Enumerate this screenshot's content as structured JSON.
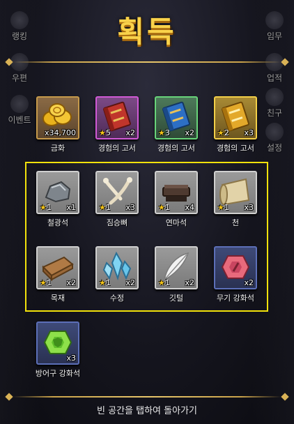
{
  "title": "획득",
  "side_menu": {
    "left": [
      "랭킹",
      "우편",
      "이벤트"
    ],
    "right": [
      "임무",
      "업적",
      "친구",
      "설정"
    ]
  },
  "items": [
    {
      "name": "금화",
      "qty": "x34,700",
      "stars": "",
      "icon": "gold-coins-icon",
      "frame": "gold"
    },
    {
      "name": "경험의 고서",
      "qty": "x2",
      "stars": "5",
      "icon": "red-book-icon",
      "frame": "purple"
    },
    {
      "name": "경험의 고서",
      "qty": "x2",
      "stars": "3",
      "icon": "blue-book-icon",
      "frame": "green"
    },
    {
      "name": "경험의 고서",
      "qty": "x3",
      "stars": "2",
      "icon": "gold-book-icon",
      "frame": "yellow"
    },
    {
      "name": "철광석",
      "qty": "x1",
      "stars": "1",
      "icon": "iron-ore-icon",
      "frame": "grey"
    },
    {
      "name": "짐승뼈",
      "qty": "x3",
      "stars": "1",
      "icon": "bone-icon",
      "frame": "grey"
    },
    {
      "name": "연마석",
      "qty": "x4",
      "stars": "1",
      "icon": "whetstone-icon",
      "frame": "grey"
    },
    {
      "name": "천",
      "qty": "x3",
      "stars": "1",
      "icon": "cloth-roll-icon",
      "frame": "grey"
    },
    {
      "name": "목재",
      "qty": "x2",
      "stars": "1",
      "icon": "wood-plank-icon",
      "frame": "grey"
    },
    {
      "name": "수정",
      "qty": "x2",
      "stars": "1",
      "icon": "crystal-icon",
      "frame": "grey"
    },
    {
      "name": "깃털",
      "qty": "x2",
      "stars": "1",
      "icon": "feather-icon",
      "frame": "grey"
    },
    {
      "name": "무기 강화석",
      "qty": "x2",
      "stars": "",
      "icon": "weapon-stone-icon",
      "frame": "navy"
    },
    {
      "name": "방어구 강화석",
      "qty": "x3",
      "stars": "",
      "icon": "armor-stone-icon",
      "frame": "navy"
    }
  ],
  "footer": "빈 공간을 탭하여 돌아가기",
  "colors": {
    "title": "#f9d24a",
    "highlight": "#f2e20b",
    "divider": "#d9b256"
  }
}
